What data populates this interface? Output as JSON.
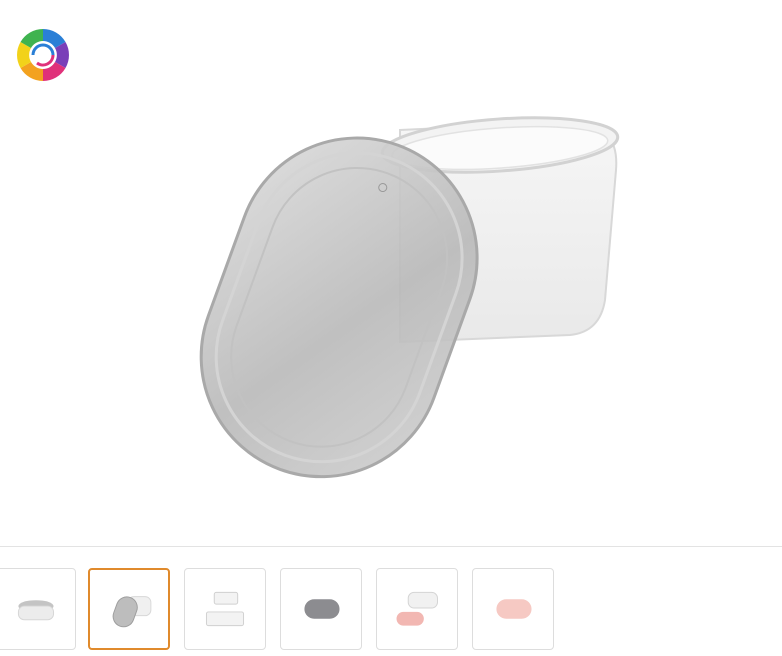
{
  "brand": {
    "logo_icon": "rainbow-swirl-logo-icon"
  },
  "gallery": {
    "main_image_icon": "oval-container-with-lid-image",
    "selected_index": 1,
    "accent_color": "#e08a2c",
    "thumbnails": [
      {
        "icon": "container-side-view-thumbnail"
      },
      {
        "icon": "container-with-lid-angled-thumbnail"
      },
      {
        "icon": "stacked-containers-thumbnail"
      },
      {
        "icon": "gray-lid-thumbnail"
      },
      {
        "icon": "pink-lid-containers-thumbnail"
      },
      {
        "icon": "pink-lid-thumbnail"
      }
    ]
  }
}
